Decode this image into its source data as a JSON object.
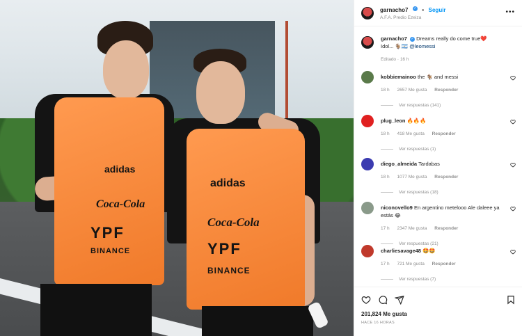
{
  "post": {
    "username": "garnacho7",
    "follow_label": "Seguir",
    "location": "A.F.A. Predio Ezeiza",
    "caption_text": "Dreams really do come true❤️",
    "caption_line2": "Idol... 🐐🇦🇷",
    "caption_mention": "@leomessi",
    "edited_text": "Editado · 16 h",
    "likes_text": "201,824 Me gusta",
    "time_text": "HACE 16 HORAS"
  },
  "comments": [
    {
      "username": "kobbiemainoo",
      "text": "the 🐐 and messi",
      "age": "18 h",
      "likes": "2657 Me gusta",
      "reply": "Responder",
      "view_replies": "Ver respuestas (141)",
      "avatar_color": "#5a7a4a"
    },
    {
      "username": "plug_leon",
      "text": "🔥🔥🔥",
      "age": "18 h",
      "likes": "418 Me gusta",
      "reply": "Responder",
      "view_replies": "Ver respuestas (1)",
      "avatar_color": "#e02020"
    },
    {
      "username": "diego_almeida",
      "text": "Tardabas",
      "age": "18 h",
      "likes": "1077 Me gusta",
      "reply": "Responder",
      "view_replies": "Ver respuestas (18)",
      "avatar_color": "#3b3bb0"
    },
    {
      "username": "niconovello9",
      "text": "En argentino metelooo Ale daleee ya estás 😂",
      "age": "17 h",
      "likes": "2347 Me gusta",
      "reply": "Responder",
      "view_replies": "Ver respuestas (21)",
      "avatar_color": "#8a9a8a"
    },
    {
      "username": "charliesavage48",
      "text": "🤩🤩",
      "age": "17 h",
      "likes": "721 Me gusta",
      "reply": "Responder",
      "view_replies": "Ver respuestas (7)",
      "avatar_color": "#c0392b"
    }
  ],
  "photo": {
    "bib_brand_1": "adidas",
    "bib_brand_2": "Coca-Cola",
    "bib_brand_3": "YPF",
    "bib_brand_4": "BINANCE"
  },
  "icons": [
    "heart-icon",
    "comment-icon",
    "share-icon",
    "bookmark-icon",
    "more-options-icon",
    "verified-icon"
  ],
  "colors": {
    "accent": "#0095f6",
    "verified": "#3897f0",
    "bib": "#f58a3a"
  }
}
